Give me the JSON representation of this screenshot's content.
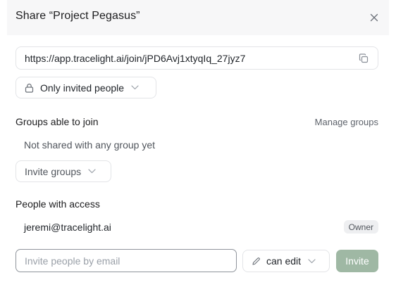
{
  "dialog": {
    "title": "Share “Project Pegasus”",
    "close_icon": "close-icon"
  },
  "link": {
    "url": "https://app.tracelight.ai/join/jPD6Avj1xtyqIq_27jyz7",
    "copy_icon": "copy-icon"
  },
  "access": {
    "selected": "Only invited people",
    "icon": "lock-icon"
  },
  "groups": {
    "label": "Groups able to join",
    "manage_label": "Manage groups",
    "empty_text": "Not shared with any group yet",
    "invite_label": "Invite groups"
  },
  "people": {
    "label": "People with access",
    "items": [
      {
        "email": "jeremi@tracelight.ai",
        "role": "Owner"
      }
    ]
  },
  "invite": {
    "placeholder": "Invite people by email",
    "permission": "can edit",
    "permission_icon": "pencil-icon",
    "button_label": "Invite"
  },
  "colors": {
    "invite_button": "#9fb8a4",
    "header_bg": "#f7f7f8"
  }
}
